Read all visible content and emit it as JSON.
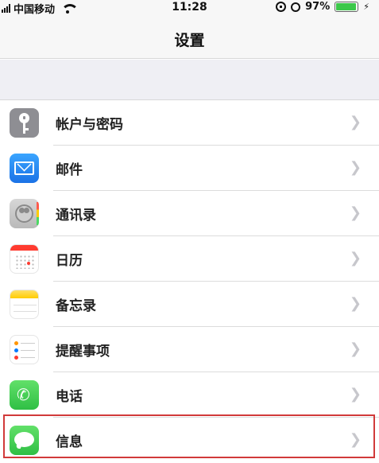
{
  "status_bar": {
    "carrier": "中国移动",
    "time": "11:28",
    "battery": "97%",
    "battery_level": 0.97,
    "icons": [
      "signal-icon",
      "wifi-icon",
      "rotation-lock-icon",
      "alarm-icon",
      "battery-icon",
      "charging-icon"
    ]
  },
  "nav": {
    "title": "设置"
  },
  "settings": {
    "items": [
      {
        "label": "帐户与密码",
        "icon": "key-icon"
      },
      {
        "label": "邮件",
        "icon": "mail-icon"
      },
      {
        "label": "通讯录",
        "icon": "contacts-icon"
      },
      {
        "label": "日历",
        "icon": "calendar-icon"
      },
      {
        "label": "备忘录",
        "icon": "notes-icon"
      },
      {
        "label": "提醒事项",
        "icon": "reminders-icon"
      },
      {
        "label": "电话",
        "icon": "phone-icon"
      },
      {
        "label": "信息",
        "icon": "messages-icon"
      }
    ]
  },
  "colors": {
    "highlight_border": "#d13a3a",
    "chevron": "#c7c7cc",
    "battery_fill": "#3cc84a"
  }
}
